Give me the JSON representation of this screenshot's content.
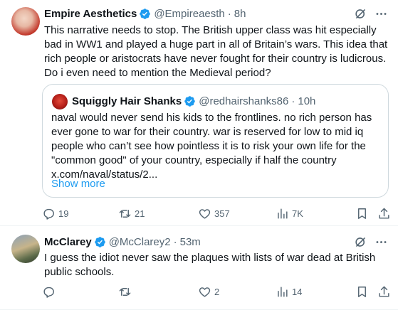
{
  "tweets": [
    {
      "author": {
        "name": "Empire Aesthetics",
        "handle": "@Empireaesth",
        "time": "8h"
      },
      "text": "This narrative needs to stop. The British upper class was hit especially bad in WW1 and played a huge part in all of Britain’s wars. This idea that rich people or aristocrats have never fought for their country is ludicrous. Do i even need to mention the Medieval period?",
      "quote": {
        "name": "Squiggly Hair Shanks",
        "handle": "@redhairshanks86",
        "time": "10h",
        "text": "naval would never send his kids to the frontlines. no rich person has ever gone to war for their country. war is reserved for low to mid iq people who can’t see how pointless it is to risk your own life for the \"common good\" of your country, especially if half the country x.com/naval/status/2...",
        "show_more": "Show more"
      },
      "stats": {
        "replies": "19",
        "retweets": "21",
        "likes": "357",
        "views": "7K"
      }
    },
    {
      "author": {
        "name": "McClarey",
        "handle": "@McClarey2",
        "time": "53m"
      },
      "text": "I guess the idiot never saw the plaques with lists of war dead at British public schools.",
      "stats": {
        "replies": "",
        "retweets": "",
        "likes": "2",
        "views": "14"
      }
    }
  ],
  "header_dot": "·",
  "colors": {
    "verified": "#1d9bf0",
    "secondary_text": "#536471",
    "link": "#1d9bf0",
    "border": "#cfd9de"
  },
  "icons": [
    "verified-badge-icon",
    "grok-icon",
    "more-icon",
    "reply-icon",
    "retweet-icon",
    "like-icon",
    "views-icon",
    "bookmark-icon",
    "share-icon"
  ]
}
